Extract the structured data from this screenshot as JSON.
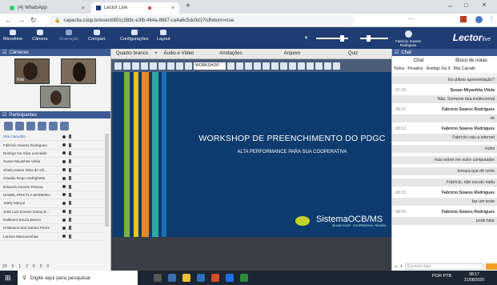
{
  "browser": {
    "tabs": [
      {
        "label": "(4) WhatsApp",
        "icon": "whatsapp-icon"
      },
      {
        "label": "Lector Live",
        "icon": "lector-icon"
      }
    ],
    "url": "capacita.coop.br/event/801c389c-e3fb-464a-8687-ca4a6c5dc0d1?isReturn=true"
  },
  "header": {
    "buttons": [
      "Microfone",
      "Câmera",
      "Gravação",
      "Compart."
    ],
    "config": [
      "Configurações",
      "Layout"
    ],
    "user": "Fabrício Soares Rodrigues",
    "logo": "Lector",
    "logo_suffix": "live"
  },
  "cameras": {
    "title": "Câmeras",
    "names": [
      "Rob",
      "",
      ""
    ]
  },
  "participants": {
    "title": "Participantes",
    "list": [
      "Rita Carvalho",
      "Fabrício Soares Rodrigues",
      "Rodrigo Da Silva Leocádio",
      "Susan Miyashita Vilela",
      "Sheila Maise Silva de Oli...",
      "Claudio Rego Andrighetto",
      "Eduardo Soares Pessoa",
      "IZABEL PRICYLA MOREIRA",
      "Jaiely Marçal",
      "José Luiz Gomes Garay B...",
      "Katlheen Souza Bueno",
      "Kristianne dos Santos Perez",
      "Larissa Mascarenhas"
    ],
    "footer": [
      "20",
      "0",
      "1",
      "2",
      "0",
      "0",
      "0"
    ]
  },
  "center": {
    "tabs": [
      "Quadro branco",
      "Áudio e Vídeo",
      "Anotações",
      "Arquivo",
      "Quiz"
    ],
    "toolbar_dropdown": "WORKSHOP D...",
    "slide": {
      "title": "WORKSHOP DE PREENCHIMENTO DO PDGC",
      "subtitle": "ALTA PERFORMANCE PARA SUA COOPERATIVA",
      "brand": "SistemaOCB/MS",
      "brand_tag": "SEJAM COOP · COOPERATIVA · REGIÃO"
    }
  },
  "chat": {
    "title": "Chat",
    "tabs": [
      "Chat",
      "Bloco de notas"
    ],
    "recipients": [
      "Todos",
      "Privativo",
      "Rodrigo Da S",
      "Rita Carvalh"
    ],
    "messages": [
      {
        "type": "bubble",
        "text": "Irá utilizar apresentação?"
      },
      {
        "type": "sender",
        "time": "07:10",
        "text": "Susan Miyashita Vilela"
      },
      {
        "type": "bubble",
        "text": "Não. Somente fala institucional"
      },
      {
        "type": "sender",
        "time": "08:12",
        "text": "Fabrício Soares Rodrigues"
      },
      {
        "type": "bubble",
        "text": "ok"
      },
      {
        "type": "sender",
        "time": "08:12",
        "text": "Fabrício Soares Rodrigues"
      },
      {
        "type": "bubble",
        "text": "Fabrício caiu a internet"
      },
      {
        "type": "bubble",
        "text": "voltei"
      },
      {
        "type": "bubble",
        "text": "mas entrei em outro computador"
      },
      {
        "type": "bubble",
        "text": "tomara que dê certo"
      },
      {
        "type": "bubble",
        "text": "Fabrício, não escuto nada"
      },
      {
        "type": "sender",
        "time": "08:15",
        "text": "Fabrício Soares Rodrigues"
      },
      {
        "type": "bubble",
        "text": "faz um teste"
      },
      {
        "type": "sender",
        "time": "08:16",
        "text": "Fabrício Soares Rodrigues"
      },
      {
        "type": "bubble",
        "text": "pode falar"
      }
    ],
    "input_placeholder": "Escreva aqui"
  },
  "taskbar": {
    "search": "Digite aqui para pesquisar",
    "lang": "POR PTB",
    "time": "08:17",
    "date": "21/08/2020"
  },
  "colors": {
    "header": "#1f3c73",
    "slide_bg": "#0d3b6e",
    "accent_orange": "#e58a2b",
    "accent_green": "#7ab24a"
  }
}
